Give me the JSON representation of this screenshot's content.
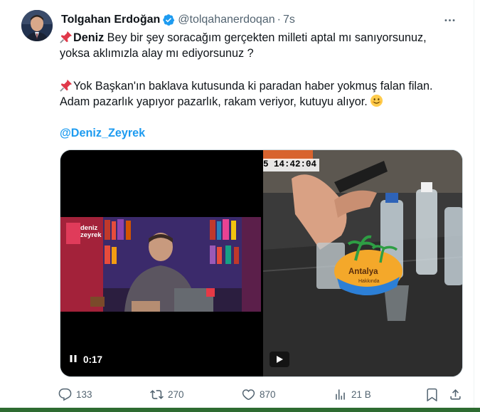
{
  "tweet": {
    "author_name": "Tolgahan Erdoğan",
    "handle": "@tolqahanerdoqan",
    "separator": "·",
    "time": "7s",
    "line1_bold": "Deniz",
    "line1_rest": " Bey bir şey soracağım gerçekten milleti aptal mı sanıyorsunuz,",
    "line2": "yoksa aklımızla alay mı ediyorsunuz ?",
    "line3": "Yok Başkan'ın baklava kutusunda ki paradan haber yokmuş falan filan.",
    "line4": "Adam pazarlık yapıyor pazarlık, rakam veriyor, kutuyu alıyor.",
    "mention": "@Deniz_Zeyrek"
  },
  "media": {
    "left_video_time": "0:17",
    "left_overlay_line1": "deniz",
    "left_overlay_line2": "zeyrek",
    "right_timestamp": "5 14:42:04",
    "right_logo_word": "Antalya",
    "right_logo_sub": "Hakkında"
  },
  "actions": {
    "replies": "133",
    "reposts": "270",
    "likes": "870",
    "views": "21 B"
  },
  "colors": {
    "text": "#0f1419",
    "secondary": "#536471",
    "accent": "#1d9bf0",
    "border": "#cfd9de"
  },
  "icons": [
    "verified-badge-icon",
    "more-icon",
    "pin-icon",
    "smile-emoji-icon",
    "pause-icon",
    "play-icon",
    "reply-icon",
    "repost-icon",
    "like-icon",
    "views-icon",
    "bookmark-icon",
    "share-icon"
  ]
}
